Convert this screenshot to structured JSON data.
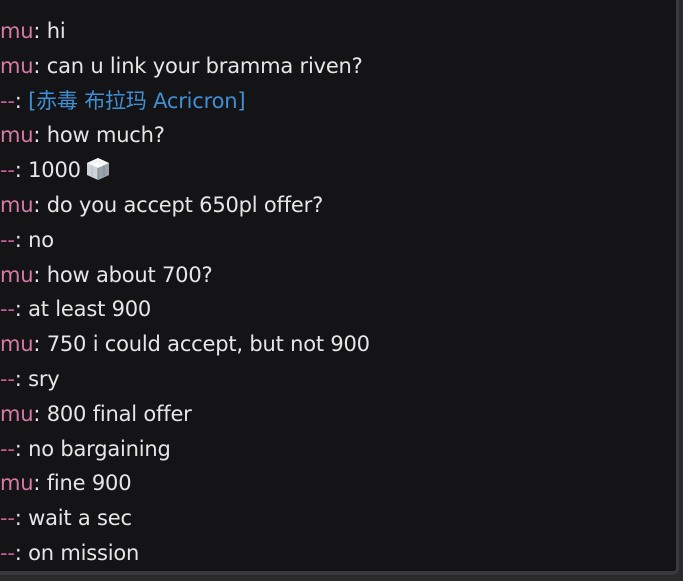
{
  "colors": {
    "background": "#141416",
    "text": "#e6e6e6",
    "sender_me": "#d77aa6",
    "sender_other": "#c85e95",
    "item_link": "#3f8fd4"
  },
  "messages": [
    {
      "sender": "mu",
      "text": "hi"
    },
    {
      "sender": "mu",
      "text": "can u link your bramma riven?"
    },
    {
      "sender": "--",
      "text": "",
      "link": "[赤毒 布拉玛 Acricron]"
    },
    {
      "sender": "mu",
      "text": "how much?"
    },
    {
      "sender": "--",
      "text": "1000",
      "icon": "platinum-icon"
    },
    {
      "sender": "mu",
      "text": "do you accept 650pl offer?"
    },
    {
      "sender": "--",
      "text": "no"
    },
    {
      "sender": "mu",
      "text": "how about 700?"
    },
    {
      "sender": "--",
      "text": "at least 900"
    },
    {
      "sender": "mu",
      "text": "750 i could accept, but not 900"
    },
    {
      "sender": "--",
      "text": "sry"
    },
    {
      "sender": "mu",
      "text": "800 final offer"
    },
    {
      "sender": "--",
      "text": "no bargaining"
    },
    {
      "sender": "mu",
      "text": "fine 900"
    },
    {
      "sender": "--",
      "text": "wait a sec"
    },
    {
      "sender": "--",
      "text": "on mission"
    }
  ]
}
